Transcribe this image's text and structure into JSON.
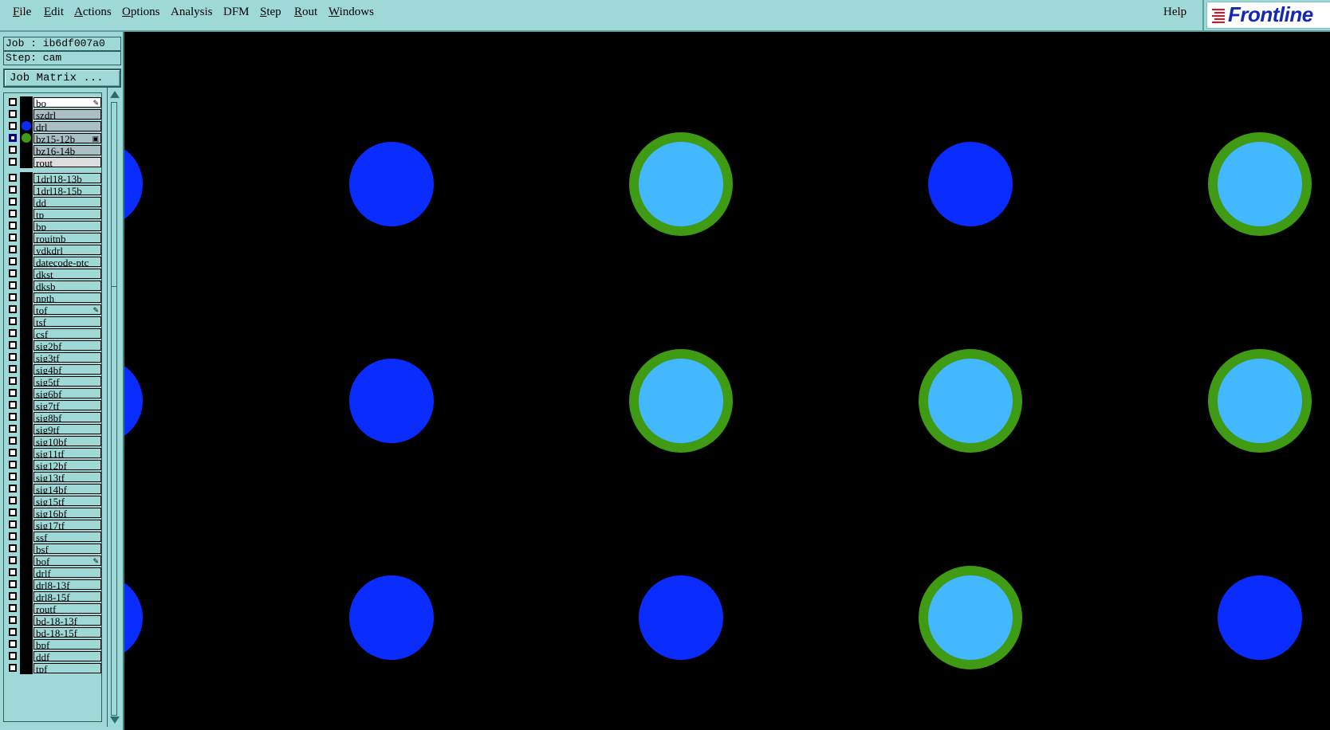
{
  "menubar": {
    "items": [
      {
        "label": "File",
        "underline": "F"
      },
      {
        "label": "Edit",
        "underline": "E"
      },
      {
        "label": "Actions",
        "underline": "A"
      },
      {
        "label": "Options",
        "underline": "O"
      },
      {
        "label": "Analysis",
        "underline": ""
      },
      {
        "label": "DFM",
        "underline": ""
      },
      {
        "label": "Step",
        "underline": "S"
      },
      {
        "label": "Rout",
        "underline": "R"
      },
      {
        "label": "Windows",
        "underline": "W"
      }
    ],
    "help": "Help"
  },
  "brand": {
    "logo_text": "Frontline"
  },
  "job_panel": {
    "job": "Job : ib6df007a0",
    "step": "Step: cam",
    "job_matrix_button": "Job Matrix ..."
  },
  "layers": [
    {
      "name": "bo",
      "style": "white",
      "flag": "pencil"
    },
    {
      "name": "szdrl",
      "style": "gray"
    },
    {
      "name": "drl",
      "style": "gray",
      "dot": "#0a2cff"
    },
    {
      "name": "bz15-12b",
      "style": "gray",
      "dot": "#3f9a14",
      "selected": true,
      "flag": "box"
    },
    {
      "name": "bz16-14b",
      "style": "gray"
    },
    {
      "name": "rout",
      "style": "lightgray"
    },
    {
      "name": "1drl18-13b"
    },
    {
      "name": "1drl18-15b"
    },
    {
      "name": "dd"
    },
    {
      "name": "tp"
    },
    {
      "name": "bp"
    },
    {
      "name": "roujtnb"
    },
    {
      "name": "ydkdrl"
    },
    {
      "name": "datecode-ptc"
    },
    {
      "name": "dkst"
    },
    {
      "name": "dksb"
    },
    {
      "name": "npth"
    },
    {
      "name": "tof",
      "flag": "pencil"
    },
    {
      "name": "tsf"
    },
    {
      "name": "csf"
    },
    {
      "name": "sig2bf"
    },
    {
      "name": "sig3tf"
    },
    {
      "name": "sig4bf"
    },
    {
      "name": "sig5tf"
    },
    {
      "name": "sig6bf"
    },
    {
      "name": "sig7tf"
    },
    {
      "name": "sig8bf"
    },
    {
      "name": "sig9tf"
    },
    {
      "name": "sig10bf"
    },
    {
      "name": "sig11tf"
    },
    {
      "name": "sig12bf"
    },
    {
      "name": "sig13tf"
    },
    {
      "name": "sig14bf"
    },
    {
      "name": "sig15tf"
    },
    {
      "name": "sig16bf"
    },
    {
      "name": "sig17tf"
    },
    {
      "name": "ssf"
    },
    {
      "name": "bsf"
    },
    {
      "name": "bof",
      "flag": "pencil"
    },
    {
      "name": "drlf"
    },
    {
      "name": "drl8-13f"
    },
    {
      "name": "drl8-15f"
    },
    {
      "name": "routf"
    },
    {
      "name": "bd-18-13f"
    },
    {
      "name": "bd-18-15f"
    },
    {
      "name": "bpf"
    },
    {
      "name": "ddf"
    },
    {
      "name": "tpf"
    }
  ],
  "canvas": {
    "background": "#000000",
    "colors": {
      "drl_pad": "#0a2cff",
      "ring": "#3f9a14",
      "pad_fill": "#44b8ff"
    },
    "pads": [
      {
        "type": "drl"
      },
      {
        "type": "drl"
      },
      {
        "type": "ring"
      },
      {
        "type": "drl"
      },
      {
        "type": "ring"
      },
      {
        "type": "drl"
      },
      {
        "type": "drl"
      },
      {
        "type": "ring"
      },
      {
        "type": "ring"
      },
      {
        "type": "ring"
      },
      {
        "type": "drl"
      },
      {
        "type": "drl"
      },
      {
        "type": "drl"
      },
      {
        "type": "ring"
      },
      {
        "type": "drl"
      }
    ]
  }
}
